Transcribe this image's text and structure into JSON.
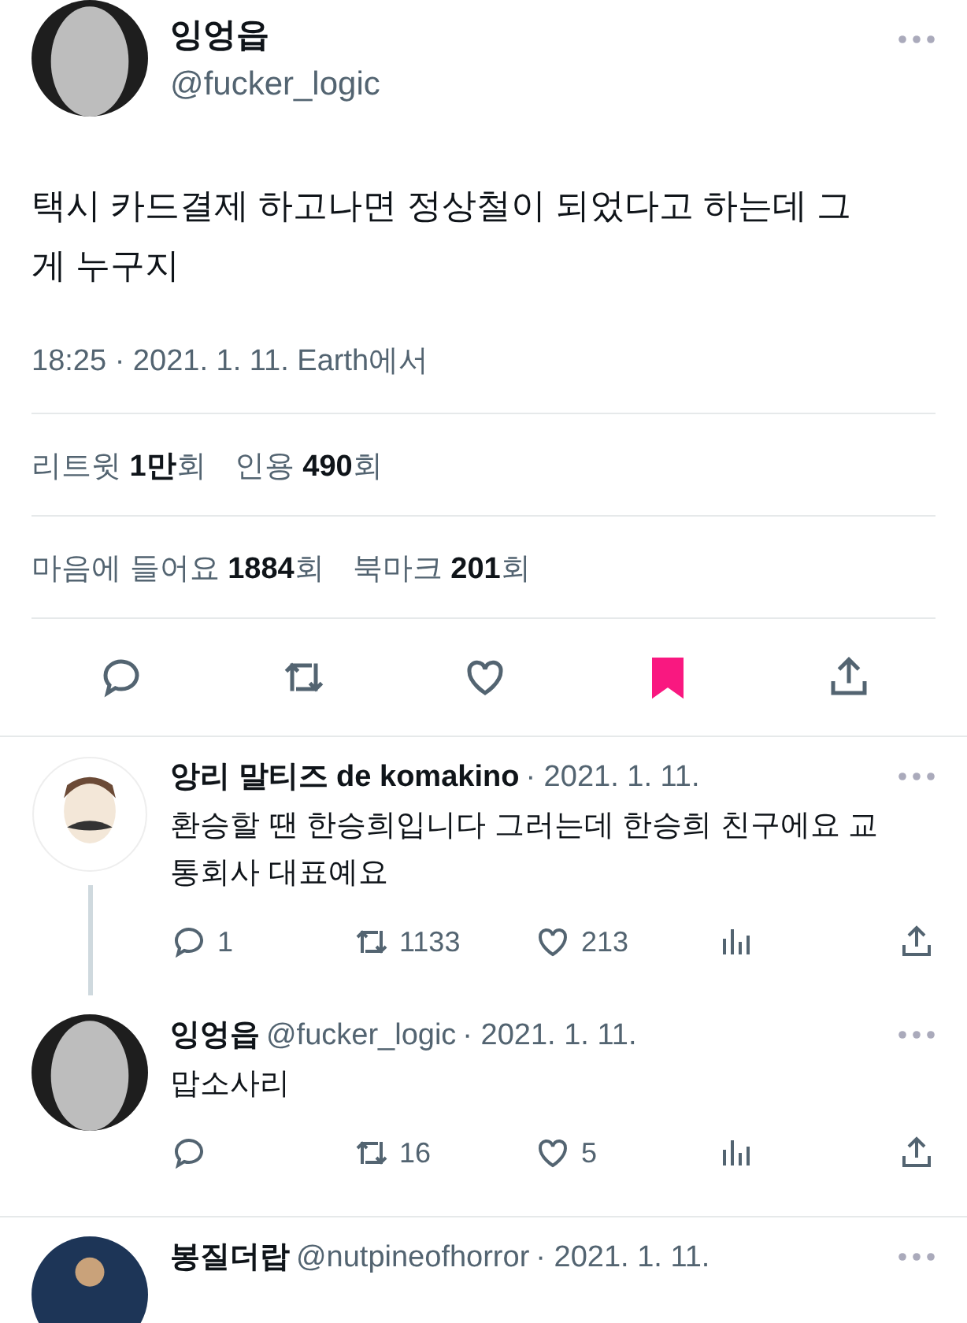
{
  "tweet": {
    "name": "잉엉읍",
    "handle": "@fucker_logic",
    "text": "택시 카드결제 하고나면 정상철이 되었다고 하는데 그게 누구지",
    "meta": "18:25 · 2021. 1. 11. Earth에서",
    "stats": [
      [
        {
          "label": "리트윗",
          "value": "1만",
          "unit": "회"
        },
        {
          "label": "인용",
          "value": "490",
          "unit": "회"
        }
      ],
      [
        {
          "label": "마음에 들어요",
          "value": "1884",
          "unit": "회"
        },
        {
          "label": "북마크",
          "value": "201",
          "unit": "회"
        }
      ]
    ],
    "bookmarked": true
  },
  "replies": [
    {
      "name": "앙리 말티즈 de komakino",
      "date": "· 2021. 1. 11.",
      "text": "환승할 땐 한승희입니다 그러는데 한승희 친구에요 교통회사 대표예요",
      "thread_line": true,
      "replies": "1",
      "retweets": "1133",
      "likes": "213"
    },
    {
      "name": "잉엉읍",
      "handle": "@fucker_logic",
      "date": "· 2021. 1. 11.",
      "text": "맙소사리",
      "thread_line": false,
      "retweets": "16",
      "likes": "5"
    },
    {
      "name": "봉질더랍",
      "handle": "@nutpineofhorror",
      "date": "· 2021. 1. 11.",
      "thread_line": false
    }
  ]
}
